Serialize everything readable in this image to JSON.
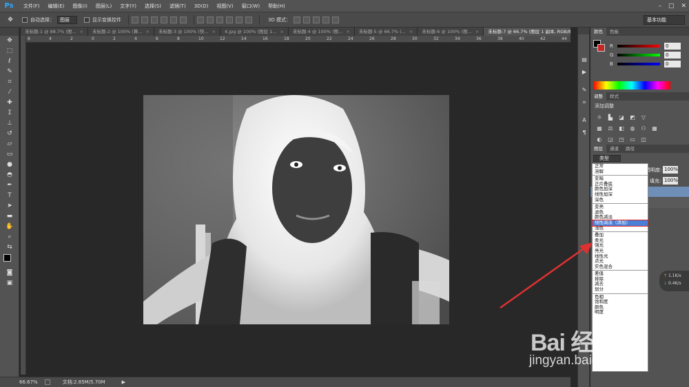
{
  "app": {
    "logo": "Ps"
  },
  "menubar": {
    "items": [
      "文件(F)",
      "编辑(E)",
      "图像(I)",
      "图层(L)",
      "文字(Y)",
      "选择(S)",
      "滤镜(T)",
      "3D(D)",
      "视图(V)",
      "窗口(W)",
      "帮助(H)"
    ],
    "window_controls": [
      "–",
      "□",
      "✕"
    ]
  },
  "options_bar": {
    "auto_select_label": "自动选择：",
    "auto_select_value": "图层",
    "show_transform_label": "显示变换控件",
    "mode_3d_label": "3D 模式：",
    "workspace": "基本功能"
  },
  "tabs": [
    {
      "label": "未标题-1 @ 88.7% (图...",
      "active": false
    },
    {
      "label": "未标题-2 @ 100% (算...",
      "active": false
    },
    {
      "label": "未标题-3 @ 100% (快...",
      "active": false
    },
    {
      "label": "4.jpg @ 100% (图层 1...",
      "active": false
    },
    {
      "label": "未标题-4 @ 100% (图...",
      "active": false
    },
    {
      "label": "未标题-5 @ 66.7% (...",
      "active": false
    },
    {
      "label": "未标题-6 @ 100% (图...",
      "active": false
    },
    {
      "label": "未标题-7 @ 66.7% (图层 1 副本, RGB/8) *",
      "active": true
    }
  ],
  "ruler_ticks": [
    "6",
    "4",
    "2",
    "0",
    "2",
    "4",
    "6",
    "8",
    "10",
    "12",
    "14",
    "16",
    "18",
    "20",
    "22",
    "24",
    "26",
    "28",
    "30",
    "32",
    "34",
    "36",
    "38",
    "40",
    "42",
    "44"
  ],
  "status": {
    "zoom": "66.67%",
    "doc": "文档:2.85M/5.70M"
  },
  "color_panel": {
    "tabs": [
      "颜色",
      "色板"
    ],
    "r_label": "R",
    "g_label": "G",
    "b_label": "B",
    "r_value": "0",
    "g_value": "0",
    "b_value": "0"
  },
  "adjust_panel": {
    "tabs": [
      "调整",
      "样式"
    ],
    "title": "添加调整"
  },
  "layers_panel": {
    "tabs": [
      "图层",
      "通道",
      "路径"
    ],
    "kind_label": "类型",
    "blend_mode": "正常",
    "opacity_label": "不透明度:",
    "opacity_value": "100%",
    "fill_label": "填充:",
    "fill_value": "100%"
  },
  "blend_dropdown": {
    "groups": [
      [
        "正常",
        "溶解"
      ],
      [
        "变暗",
        "正片叠底",
        "颜色加深",
        "线性加深",
        "深色"
      ],
      [
        "变亮",
        "滤色",
        "颜色减淡",
        "线性减淡（添加）",
        "浅色"
      ],
      [
        "叠加",
        "柔光",
        "强光",
        "亮光",
        "线性光",
        "点光",
        "实色混合"
      ],
      [
        "差值",
        "排除",
        "减去",
        "划分"
      ],
      [
        "色相",
        "饱和度",
        "颜色",
        "明度"
      ]
    ],
    "selected": "线性减淡（添加）"
  },
  "net_widget": {
    "up": "1.1K/s",
    "down": "0.4K/s"
  },
  "watermark": {
    "brand": "Bai 经验",
    "url": "jingyan.baidu.com"
  },
  "colors": {
    "accent": "#31a8ff",
    "selection": "#4a7fd8",
    "arrow": "#e03131",
    "fg_swatch": "#000000",
    "bg_swatch": "#c82626"
  }
}
